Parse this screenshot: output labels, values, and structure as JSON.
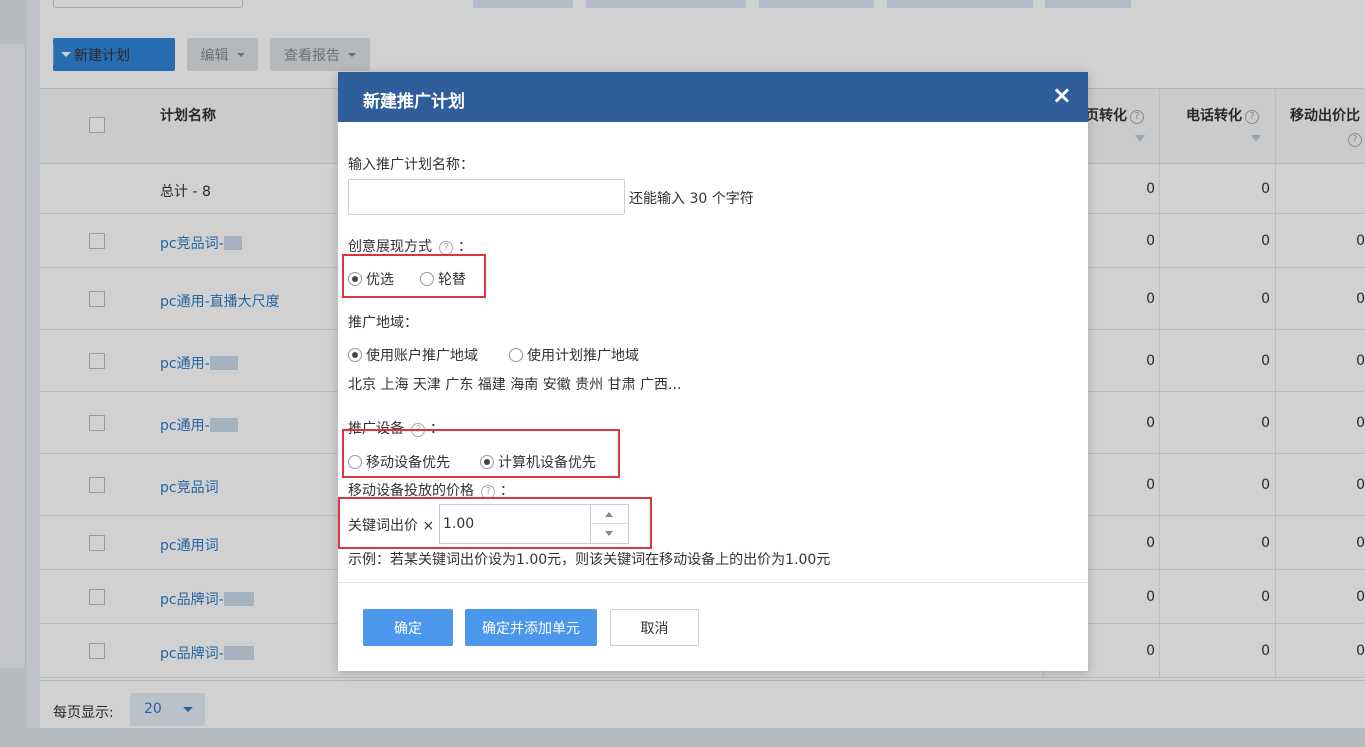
{
  "toolbar": {
    "new_plan_label": "新建计划",
    "edit_label": "编辑",
    "report_label": "查看报告"
  },
  "table": {
    "headers": {
      "name": "计划名称",
      "page_conversion": "页转化",
      "phone_conversion": "电话转化",
      "mobile_bid": "移动出价比"
    },
    "total_row": "总计 - 8",
    "rows": [
      {
        "name": "pc竞品词-",
        "page_conv": "0",
        "phone_conv": "0",
        "mobile": "0"
      },
      {
        "name": "pc通用-直播大尺度",
        "page_conv": "0",
        "phone_conv": "0",
        "mobile": "0"
      },
      {
        "name": "pc通用-",
        "page_conv": "0",
        "phone_conv": "0",
        "mobile": "0"
      },
      {
        "name": "pc通用-",
        "page_conv": "0",
        "phone_conv": "0",
        "mobile": "0"
      },
      {
        "name": "pc竞品词",
        "page_conv": "0",
        "phone_conv": "0",
        "mobile": "0"
      },
      {
        "name": "pc通用词",
        "page_conv": "0",
        "phone_conv": "0",
        "mobile": "0"
      },
      {
        "name": "pc品牌词-",
        "page_conv": "0",
        "phone_conv": "0",
        "mobile": "0"
      },
      {
        "name": "pc品牌词-",
        "page_conv": "0",
        "phone_conv": "0",
        "mobile": "0"
      }
    ],
    "total_values": {
      "page_conv": "0",
      "phone_conv": "0"
    }
  },
  "footer": {
    "per_page_label": "每页显示:",
    "per_page_value": "20"
  },
  "dialog": {
    "title": "新建推广计划",
    "close_glyph": "×",
    "name_label": "输入推广计划名称：",
    "name_value": "",
    "name_hint": "还能输入 30 个字符",
    "creative_label": "创意展现方式",
    "creative_colon": "：",
    "creative_options": [
      "优选",
      "轮替"
    ],
    "creative_selected": "优选",
    "region_label": "推广地域：",
    "region_options": [
      "使用账户推广地域",
      "使用计划推广地域"
    ],
    "region_selected": "使用账户推广地域",
    "region_list": "北京 上海 天津 广东 福建 海南 安徽 贵州 甘肃 广西...",
    "device_label": "推广设备",
    "device_colon": "：",
    "device_options": [
      "移动设备优先",
      "计算机设备优先"
    ],
    "device_selected": "计算机设备优先",
    "mobile_price_label": "移动设备投放的价格",
    "mobile_price_colon": "：",
    "bid_label": "关键词出价 ×",
    "bid_value": "1.00",
    "example_text": "示例：若某关键词出价设为1.00元，则该关键词在移动设备上的出价为1.00元",
    "buttons": {
      "confirm": "确定",
      "confirm_add_unit": "确定并添加单元",
      "cancel": "取消"
    }
  }
}
